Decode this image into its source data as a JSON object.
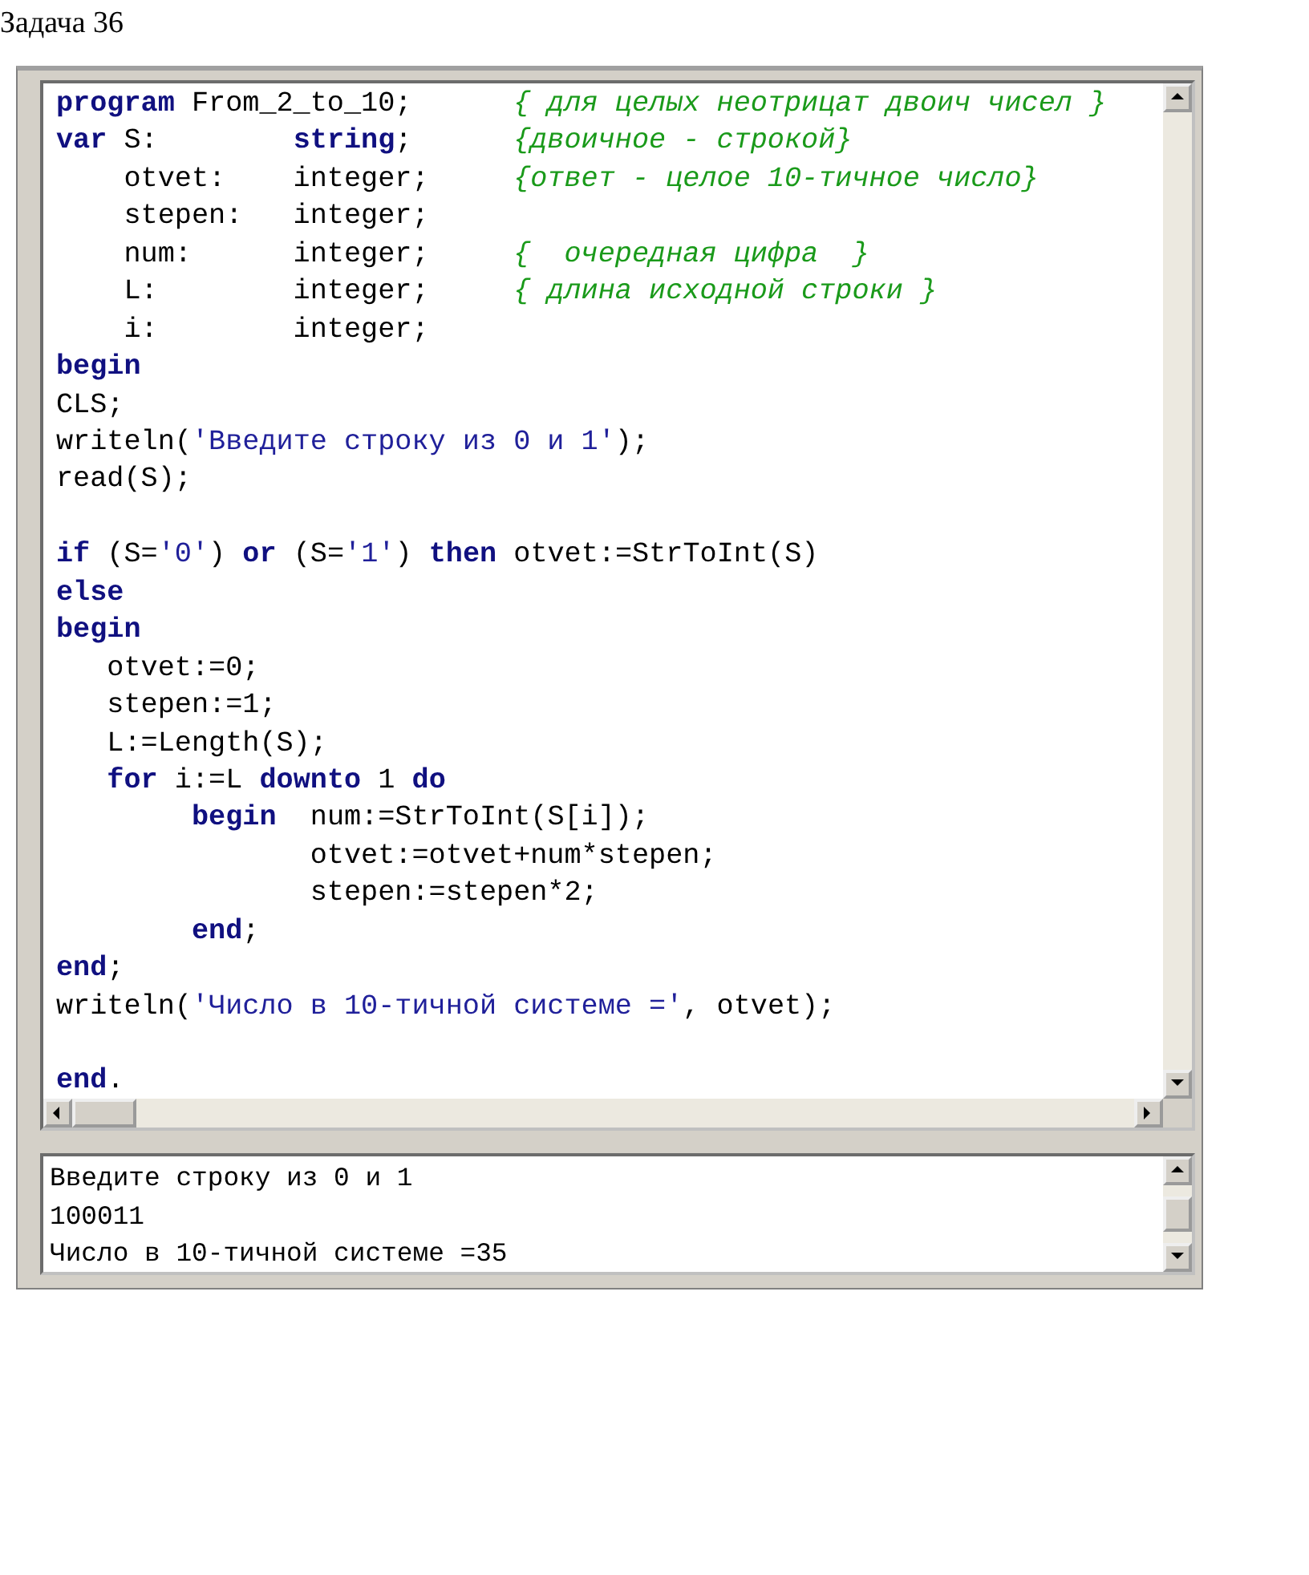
{
  "heading": "Задача 36",
  "editor": {
    "lines": [
      {
        "kind": "code",
        "tokens": [
          {
            "kind": "keyword",
            "text": "program"
          },
          {
            "kind": "plain",
            "text": " From_2_to_10;"
          }
        ],
        "comment": "{ для целых неотрицат двоич чисел }"
      },
      {
        "kind": "code",
        "tokens": [
          {
            "kind": "keyword",
            "text": "var"
          },
          {
            "kind": "plain",
            "text": " S:        "
          },
          {
            "kind": "keyword",
            "text": "string"
          },
          {
            "kind": "plain",
            "text": ";"
          }
        ],
        "comment": "{двоичное - строкой}"
      },
      {
        "kind": "code",
        "tokens": [
          {
            "kind": "plain",
            "text": "    otvet:    integer;"
          }
        ],
        "comment": "{ответ - целое 10-тичное число}"
      },
      {
        "kind": "code",
        "tokens": [
          {
            "kind": "plain",
            "text": "    stepen:   integer;"
          }
        ]
      },
      {
        "kind": "code",
        "tokens": [
          {
            "kind": "plain",
            "text": "    num:      integer;"
          }
        ],
        "comment": "{  очередная цифра  }"
      },
      {
        "kind": "code",
        "tokens": [
          {
            "kind": "plain",
            "text": "    L:        integer;"
          }
        ],
        "comment": "{ длина исходной строки }"
      },
      {
        "kind": "code",
        "tokens": [
          {
            "kind": "plain",
            "text": "    i:        integer;"
          }
        ]
      },
      {
        "kind": "code",
        "tokens": [
          {
            "kind": "keyword",
            "text": "begin"
          }
        ]
      },
      {
        "kind": "code",
        "tokens": [
          {
            "kind": "plain",
            "text": "CLS;"
          }
        ]
      },
      {
        "kind": "code",
        "tokens": [
          {
            "kind": "plain",
            "text": "writeln("
          },
          {
            "kind": "string",
            "text": "'Введите строку из 0 и 1'"
          },
          {
            "kind": "plain",
            "text": ");"
          }
        ]
      },
      {
        "kind": "code",
        "tokens": [
          {
            "kind": "plain",
            "text": "read(S);"
          }
        ]
      },
      {
        "kind": "blank"
      },
      {
        "kind": "code",
        "tokens": [
          {
            "kind": "keyword",
            "text": "if"
          },
          {
            "kind": "plain",
            "text": " (S="
          },
          {
            "kind": "string",
            "text": "'0'"
          },
          {
            "kind": "plain",
            "text": ") "
          },
          {
            "kind": "keyword",
            "text": "or"
          },
          {
            "kind": "plain",
            "text": " (S="
          },
          {
            "kind": "string",
            "text": "'1'"
          },
          {
            "kind": "plain",
            "text": ") "
          },
          {
            "kind": "keyword",
            "text": "then"
          },
          {
            "kind": "plain",
            "text": " otvet:=StrToInt(S)"
          }
        ]
      },
      {
        "kind": "code",
        "tokens": [
          {
            "kind": "keyword",
            "text": "else"
          }
        ]
      },
      {
        "kind": "code",
        "tokens": [
          {
            "kind": "keyword",
            "text": "begin"
          }
        ]
      },
      {
        "kind": "code",
        "tokens": [
          {
            "kind": "plain",
            "text": "   otvet:=0;"
          }
        ]
      },
      {
        "kind": "code",
        "tokens": [
          {
            "kind": "plain",
            "text": "   stepen:=1;"
          }
        ]
      },
      {
        "kind": "code",
        "tokens": [
          {
            "kind": "plain",
            "text": "   L:=Length(S);"
          }
        ]
      },
      {
        "kind": "code",
        "tokens": [
          {
            "kind": "keyword",
            "text": "   for"
          },
          {
            "kind": "plain",
            "text": " i:=L "
          },
          {
            "kind": "keyword",
            "text": "downto"
          },
          {
            "kind": "plain",
            "text": " 1 "
          },
          {
            "kind": "keyword",
            "text": "do"
          }
        ]
      },
      {
        "kind": "code",
        "tokens": [
          {
            "kind": "keyword",
            "text": "        begin"
          },
          {
            "kind": "plain",
            "text": "  num:=StrToInt(S[i]);"
          }
        ]
      },
      {
        "kind": "code",
        "tokens": [
          {
            "kind": "plain",
            "text": "               otvet:=otvet+num*stepen;"
          }
        ]
      },
      {
        "kind": "code",
        "tokens": [
          {
            "kind": "plain",
            "text": "               stepen:=stepen*2;"
          }
        ]
      },
      {
        "kind": "code",
        "tokens": [
          {
            "kind": "keyword",
            "text": "        end"
          },
          {
            "kind": "plain",
            "text": ";"
          }
        ]
      },
      {
        "kind": "code",
        "tokens": [
          {
            "kind": "keyword",
            "text": "end"
          },
          {
            "kind": "plain",
            "text": ";"
          }
        ]
      },
      {
        "kind": "code",
        "tokens": [
          {
            "kind": "plain",
            "text": "writeln("
          },
          {
            "kind": "string",
            "text": "'Число в 10-тичной системе ='"
          },
          {
            "kind": "plain",
            "text": ", otvet);"
          }
        ]
      },
      {
        "kind": "blank"
      },
      {
        "kind": "code",
        "tokens": [
          {
            "kind": "keyword",
            "text": "end"
          },
          {
            "kind": "plain",
            "text": "."
          }
        ]
      }
    ]
  },
  "output": {
    "lines": [
      "Введите строку из 0 и 1",
      "100011",
      "Число в 10-тичной системе =35"
    ]
  }
}
